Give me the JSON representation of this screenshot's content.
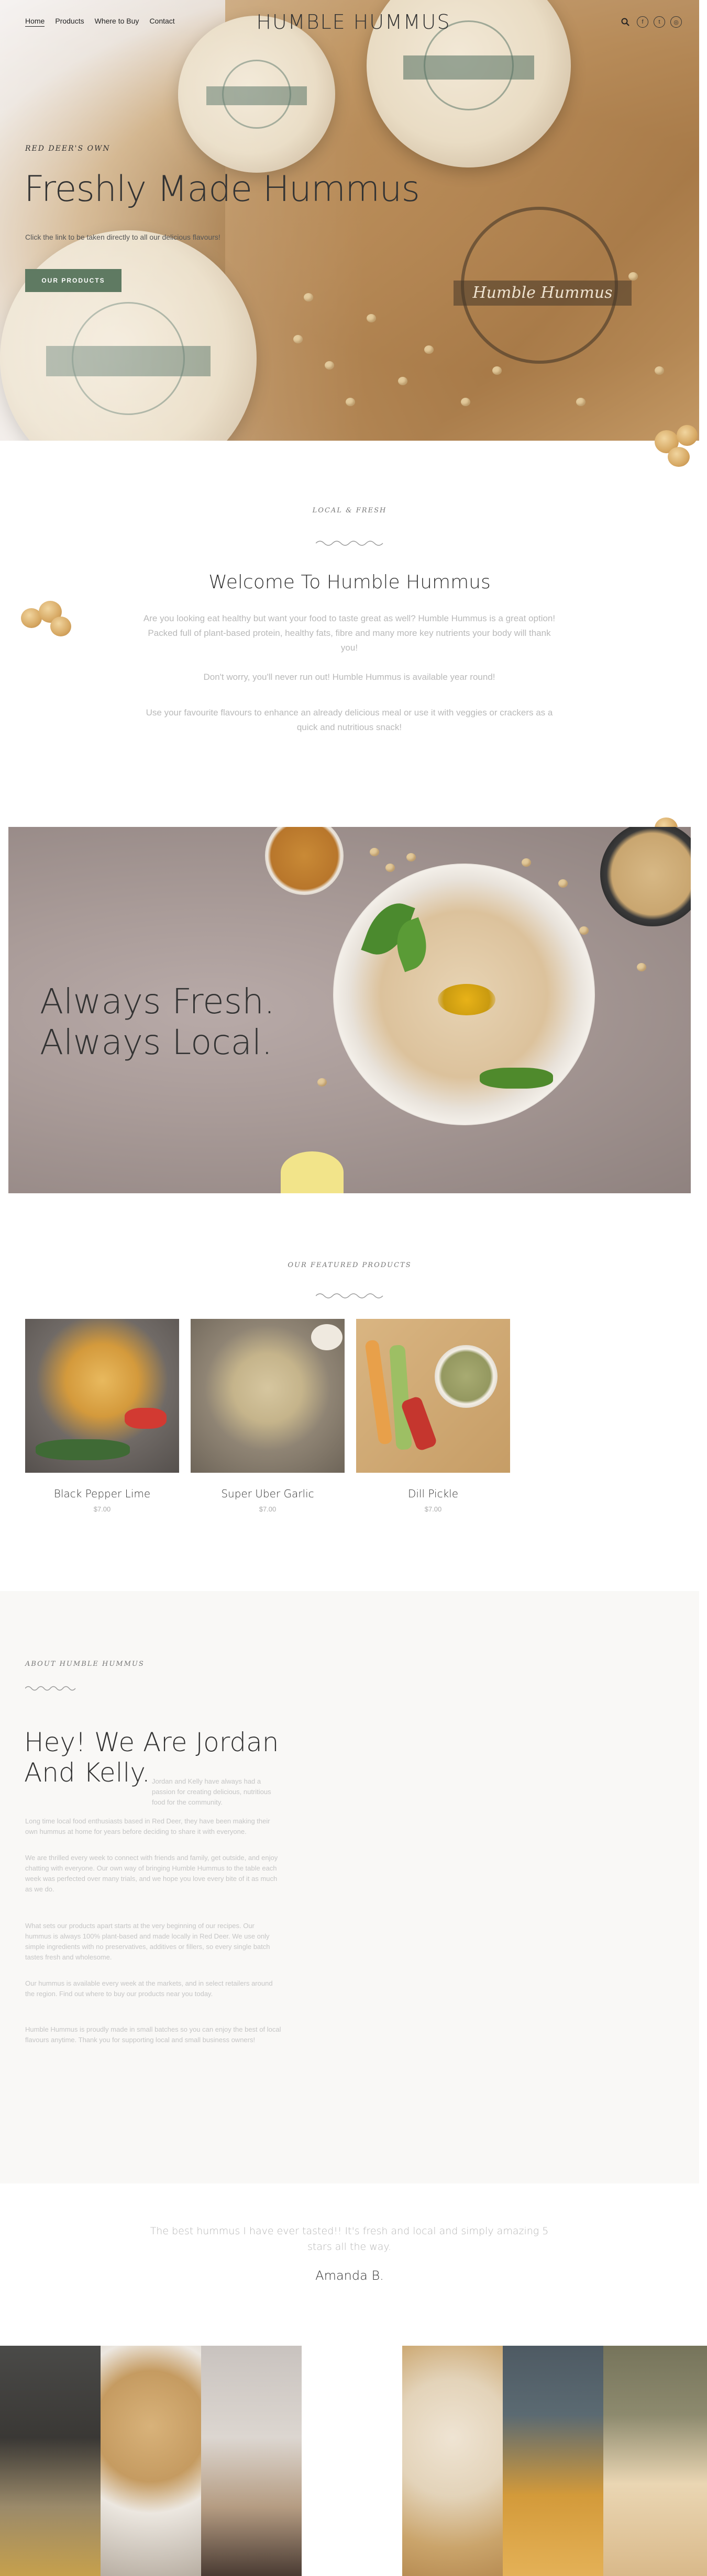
{
  "header": {
    "nav": [
      "Home",
      "Products",
      "Where to Buy",
      "Contact"
    ],
    "logo": "HUMBLE HUMMUS",
    "icons": {
      "search": "search-icon",
      "social": [
        "facebook-icon",
        "twitter-icon",
        "instagram-icon"
      ]
    }
  },
  "hero": {
    "kicker": "RED DEER'S OWN",
    "title": "Freshly Made Hummus",
    "subtitle": "Click the link to be taken directly to all our delicious flavours!",
    "button": "OUR PRODUCTS"
  },
  "welcome": {
    "kicker": "LOCAL & FRESH",
    "title": "Welcome To Humble Hummus",
    "paragraphs": [
      "Are you looking eat healthy but want your food to taste great as well? Humble Hummus is a great option! Packed full of plant-based protein, healthy fats, fibre and many more key nutrients your body will thank you!",
      "Don't worry, you'll never run out! Humble Hummus is available year round!",
      "Use your favourite flavours to enhance an already delicious meal or use it with veggies or crackers as a quick and nutritious snack!"
    ]
  },
  "fresh": {
    "line1": "Always Fresh.",
    "line2": "Always Local."
  },
  "featured": {
    "kicker": "OUR FEATURED PRODUCTS",
    "products": [
      {
        "name": "Black Pepper Lime",
        "price": "$7.00"
      },
      {
        "name": "Super Uber Garlic",
        "price": "$7.00"
      },
      {
        "name": "Dill Pickle",
        "price": "$7.00"
      }
    ]
  },
  "about": {
    "kicker": "ABOUT HUMBLE HUMMUS",
    "title": "Hey! We Are Jordan And Kelly.",
    "paragraphs": [
      "Jordan and Kelly have always had a passion for creating delicious, nutritious food for the community.",
      "Long time local food enthusiasts based in Red Deer, they have been making their own hummus at home for years before deciding to share it with everyone.",
      "We are thrilled every week to connect with friends and family, get outside, and enjoy chatting with everyone. Our own way of bringing Humble Hummus to the table each week was perfected over many trials, and we hope you love every bite of it as much as we do.",
      "What sets our products apart starts at the very beginning of our recipes. Our hummus is always 100% plant-based and made locally in Red Deer. We use only simple ingredients with no preservatives, additives or fillers, so every single batch tastes fresh and wholesome.",
      "Our hummus is available every week at the markets, and in select retailers around the region. Find out where to buy our products near you today.",
      "Humble Hummus is proudly made in small batches so you can enjoy the best of local flavours anytime. Thank you for supporting local and small business owners!"
    ]
  },
  "testimonial": {
    "quote": "The best hummus I have ever tasted!! It's fresh and local and simply amazing 5 stars all the way.",
    "name": "Amanda B."
  },
  "colors": {
    "accent_green": "#5f7a62",
    "text_dark": "#333333",
    "text_light": "#b9b9b9",
    "about_bg": "#f9f8f6"
  }
}
